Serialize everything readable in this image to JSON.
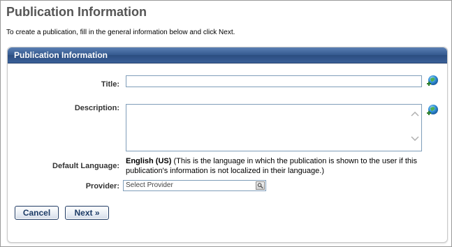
{
  "page": {
    "title": "Publication Information",
    "intro": "To create a publication, fill in the general information below and click Next."
  },
  "panel": {
    "header": "Publication Information",
    "fields": {
      "title_label": "Title:",
      "title_value": "",
      "description_label": "Description:",
      "description_value": "",
      "default_language_label": "Default Language:",
      "default_language_value": "English (US)",
      "default_language_note": "(This is the language in which the publication is shown to the user if this publication's information is not localized in their language.)",
      "provider_label": "Provider:",
      "provider_placeholder": "Select Provider"
    },
    "icons": {
      "translate": "globe-plus-icon",
      "provider_lookup": "lookup-icon"
    }
  },
  "buttons": {
    "cancel": "Cancel",
    "next": "Next »"
  },
  "colors": {
    "header_blue": "#34598f",
    "button_text": "#1c3b66",
    "title_gray": "#555555"
  }
}
